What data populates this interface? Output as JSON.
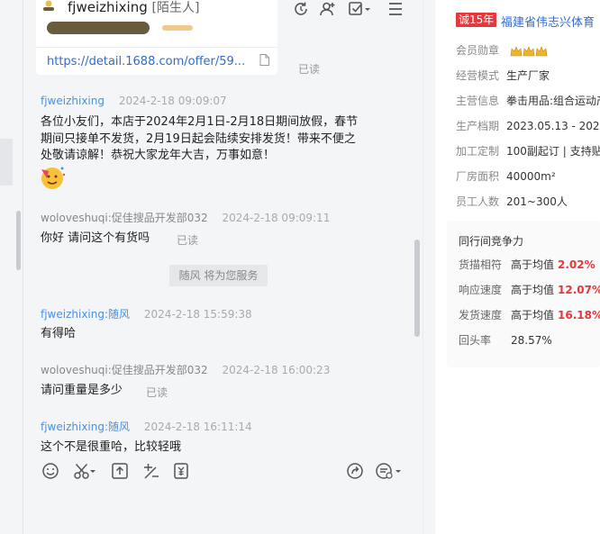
{
  "chat": {
    "contact_name": "fjweizhixing",
    "contact_tag": "[陌生人]",
    "link_card": {
      "url": "https://detail.1688.com/offer/59..."
    },
    "read_label": "已读",
    "messages": [
      {
        "sender": "fjweizhixing",
        "time": "2024-2-18 09:09:07",
        "lines": [
          "各位小友们，本店于2024年2月1日-2月18日期间放假，春节",
          "期间只接单不发货，2月19日起会陆续安排发货！带来不便之",
          "处敬请谅解！恭祝大家龙年大吉，万事如意！"
        ]
      },
      {
        "sender": "woloveshuqi:促佳搜品开发部032",
        "time": "2024-2-18 09:09:11",
        "text": "你好  请问这个有货吗"
      },
      {
        "sender": "fjweizhixing:随风",
        "time": "2024-2-18 15:59:38",
        "text": "有得哈"
      },
      {
        "sender": "woloveshuqi:促佳搜品开发部032",
        "time": "2024-2-18 16:00:23",
        "text": "请问重量是多少"
      },
      {
        "sender": "fjweizhixing:随风",
        "time": "2024-2-18 16:11:14",
        "text": "这个不是很重哈，比较轻哦"
      }
    ],
    "system_notice": "随风 将为您服务"
  },
  "shop": {
    "years_badge": "诚15年",
    "name": "福建省伟志兴体育",
    "rows": [
      {
        "key": "会员勋章",
        "value": ""
      },
      {
        "key": "经营模式",
        "value": "生产厂家"
      },
      {
        "key": "主营信息",
        "value": "拳击用品:组合运动产"
      },
      {
        "key": "生产档期",
        "value": "2023.05.13 - 2023.0"
      },
      {
        "key": "加工定制",
        "value": "100副起订 | 支持贴"
      },
      {
        "key": "厂房面积",
        "value": "40000m²"
      },
      {
        "key": "员工人数",
        "value": "201~300人"
      }
    ],
    "competitiveness": {
      "title": "同行间竞争力",
      "rows": [
        {
          "key": "货描相符",
          "value": "高于均值",
          "pct": "2.02% ↑"
        },
        {
          "key": "响应速度",
          "value": "高于均值",
          "pct": "12.07%"
        },
        {
          "key": "发货速度",
          "value": "高于均值",
          "pct": "16.18%"
        },
        {
          "key": "回头率",
          "value": "28.57%",
          "pct": ""
        }
      ]
    }
  },
  "colors": {
    "link": "#2f6bd0",
    "sender_blue": "#4a90e2",
    "accent_red": "#e4393c"
  }
}
